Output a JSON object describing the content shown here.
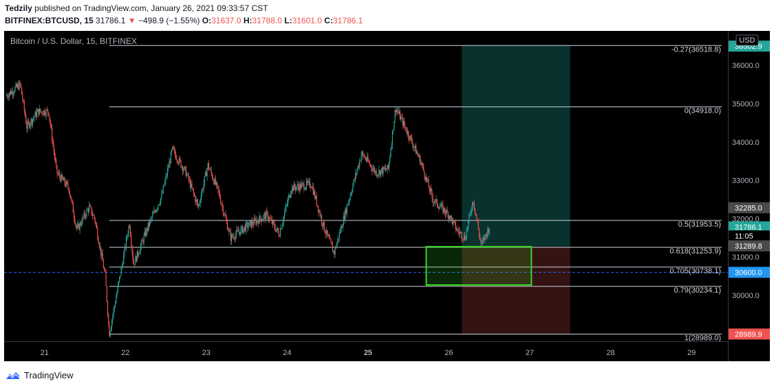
{
  "header": {
    "author": "Tedzily",
    "published_text": "published on TradingView.com, January 26, 2021 09:33:57 CST",
    "symbol": "BITFINEX:BTCUSD, 15",
    "last": "31786.1",
    "change": "−498.9 (−1.55%)",
    "open_label": "O:",
    "open": "31637.0",
    "high_label": "H:",
    "high": "31788.0",
    "low_label": "L:",
    "low": "31601.0",
    "close_label": "C:",
    "close": "31786.1"
  },
  "pane": {
    "title": "Bitcoin / U.S. Dollar, 15, BITFINEX",
    "currency_button": "USD"
  },
  "footer": {
    "brand": "TradingView"
  },
  "colors": {
    "up": "#26a69a",
    "down": "#ef5350",
    "background": "#000000",
    "fib_line": "#d1d4dc",
    "target_zone": "#0b3a36",
    "stop_zone": "#3a1515",
    "box": "#39d627",
    "dashed": "#2962ff"
  },
  "chart_data": {
    "type": "candlestick",
    "symbol": "BTCUSD",
    "interval": "15",
    "y_ticks": [
      30000,
      31000,
      32000,
      33000,
      34000,
      35000,
      36000
    ],
    "y_tick_labels": [
      "30000.0",
      "31000.0",
      "32000.0",
      "33000.0",
      "34000.0",
      "35000.0",
      "36000.0"
    ],
    "x_ticks": [
      21,
      22,
      23,
      24,
      25,
      26,
      27,
      28,
      29
    ],
    "x_tick_labels": [
      "21",
      "22",
      "23",
      "24",
      "25",
      "26",
      "27",
      "28",
      "29"
    ],
    "bold_x_label": "25",
    "y_range": [
      28800,
      36900
    ],
    "x_range": [
      20.5,
      29.45
    ],
    "close_path": [
      [
        20.52,
        35200
      ],
      [
        20.7,
        35500
      ],
      [
        20.78,
        34400
      ],
      [
        20.92,
        34800
      ],
      [
        21.05,
        34800
      ],
      [
        21.15,
        33200
      ],
      [
        21.3,
        32800
      ],
      [
        21.4,
        31700
      ],
      [
        21.55,
        32300
      ],
      [
        21.62,
        32000
      ],
      [
        21.75,
        30500
      ],
      [
        21.8,
        29000
      ],
      [
        21.95,
        30700
      ],
      [
        22.05,
        31900
      ],
      [
        22.1,
        30800
      ],
      [
        22.3,
        31900
      ],
      [
        22.45,
        32600
      ],
      [
        22.58,
        33800
      ],
      [
        22.75,
        33200
      ],
      [
        22.9,
        32300
      ],
      [
        23.02,
        33400
      ],
      [
        23.15,
        32700
      ],
      [
        23.3,
        31500
      ],
      [
        23.5,
        31800
      ],
      [
        23.75,
        32100
      ],
      [
        23.9,
        31600
      ],
      [
        24.05,
        32800
      ],
      [
        24.3,
        32900
      ],
      [
        24.45,
        31800
      ],
      [
        24.58,
        31100
      ],
      [
        24.75,
        32400
      ],
      [
        24.92,
        33700
      ],
      [
        25.1,
        33200
      ],
      [
        25.25,
        33300
      ],
      [
        25.34,
        34900
      ],
      [
        25.5,
        34200
      ],
      [
        25.65,
        33500
      ],
      [
        25.8,
        32500
      ],
      [
        26.0,
        32100
      ],
      [
        26.1,
        31700
      ],
      [
        26.2,
        31500
      ],
      [
        26.3,
        32500
      ],
      [
        26.4,
        31300
      ],
      [
        26.5,
        31786
      ]
    ],
    "fib_levels": [
      {
        "label": "-0.27(36518.8)",
        "price": 36518.8,
        "x_start": 21.8
      },
      {
        "label": "0(34918.0)",
        "price": 34918.0,
        "x_start": 21.8
      },
      {
        "label": "0.5(31953.5)",
        "price": 31953.5,
        "x_start": 21.8
      },
      {
        "label": "0.618(31253.9)",
        "price": 31253.9,
        "x_start": 21.8
      },
      {
        "label": "0.705(30738.1)",
        "price": 30738.1,
        "x_start": 21.8
      },
      {
        "label": "0.79(30234.1)",
        "price": 30234.1,
        "x_start": 21.8
      },
      {
        "label": "1(28989.0)",
        "price": 28989.0,
        "x_start": 21.8
      }
    ],
    "position": {
      "x_start": 26.16,
      "x_end": 27.5,
      "entry": 31270,
      "target": 36518.8,
      "stop": 28989.0
    },
    "highlight_box": {
      "x_start": 25.72,
      "x_end": 27.02,
      "top": 31270,
      "bottom": 30270
    },
    "dashed_price": 30600.0,
    "price_badges": [
      {
        "label": "36502.9",
        "price": 36502.9,
        "color": "#26a69a"
      },
      {
        "label": "32285.0",
        "price": 32285.0,
        "color": "#4a4a4a"
      },
      {
        "label": "31786.1",
        "price": 31786.1,
        "color": "#26a69a"
      },
      {
        "label": "11:05",
        "price": 31550,
        "color": "#000000"
      },
      {
        "label": "31289.8",
        "price": 31289.8,
        "color": "#4a4a4a"
      },
      {
        "label": "30600.0",
        "price": 30600.0,
        "color": "#2196f3"
      },
      {
        "label": "28989.9",
        "price": 28989.9,
        "color": "#ef5350"
      }
    ]
  }
}
